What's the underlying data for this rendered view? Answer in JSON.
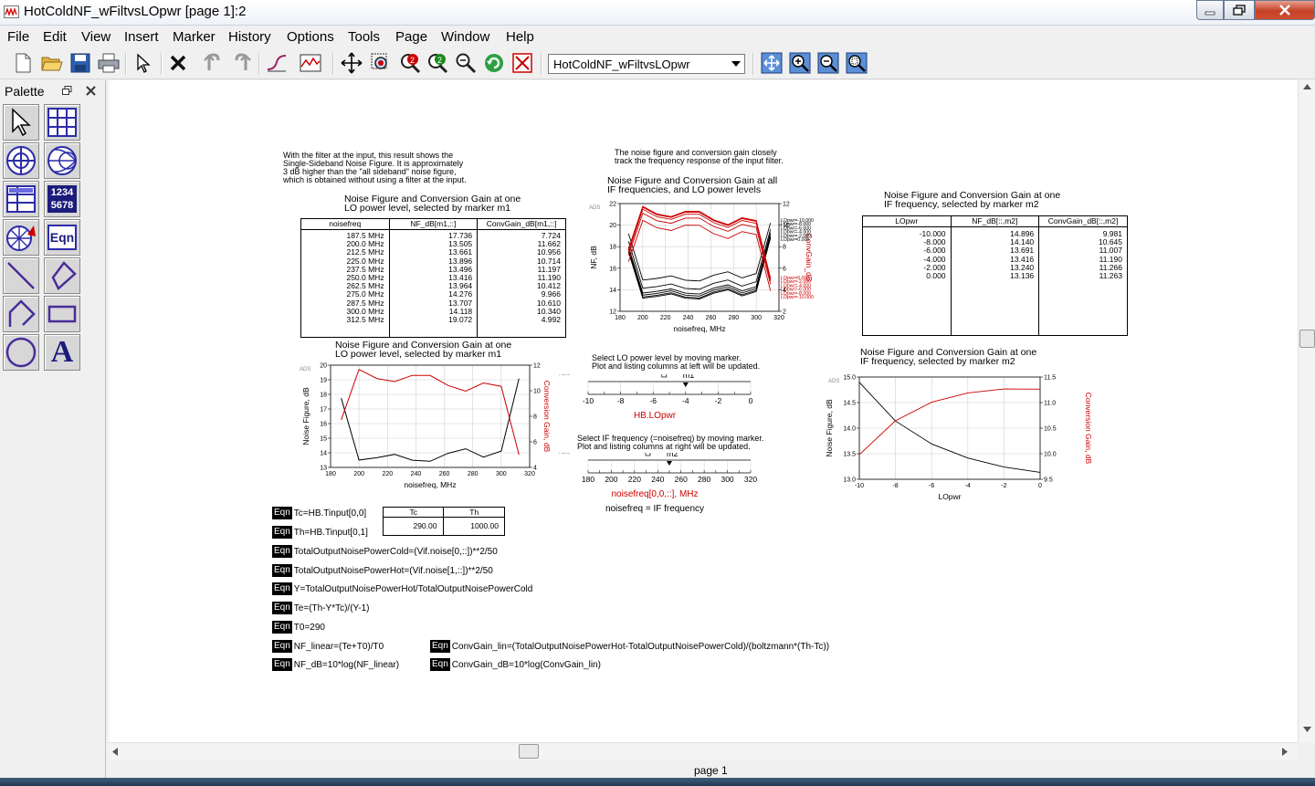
{
  "window": {
    "title": "HotColdNF_wFiltvsLOpwr [page 1]:2"
  },
  "menu": [
    "File",
    "Edit",
    "View",
    "Insert",
    "Marker",
    "History",
    "Options",
    "Tools",
    "Page",
    "Window",
    "Help"
  ],
  "toolbar": {
    "page_select": "HotColdNF_wFiltvsLOpwr"
  },
  "palette": {
    "title": "Palette",
    "counter_icon_text": [
      "1234",
      "5678"
    ],
    "eqn_icon_text": "Eqn",
    "text_icon_text": "A"
  },
  "notes": {
    "filter_note": [
      "With the filter at the input, this result shows the",
      "Single-Sideband Noise Figure.  It is approximately",
      "3 dB higher than the \"all sideband\" noise figure,",
      "which is obtained without using a filter at the input."
    ],
    "track_note": [
      "The noise figure and conversion gain closely",
      "track the frequency response of the input filter."
    ],
    "lo_marker_note": [
      "Select LO power level by moving marker.",
      "Plot and listing columns at left will be updated."
    ],
    "if_marker_note": [
      "Select IF frequency (=noisefreq) by moving marker.",
      "Plot and listing columns at right will be updated."
    ]
  },
  "table1": {
    "title": [
      "Noise Figure and Conversion Gain at one",
      "LO power level, selected by marker m1"
    ],
    "headers": [
      "noisefreq",
      "NF_dB[m1,::]",
      "ConvGain_dB[m1,::]"
    ],
    "col1": "187.5 MHz\n200.0 MHz\n212.5 MHz\n225.0 MHz\n237.5 MHz\n250.0 MHz\n262.5 MHz\n275.0 MHz\n287.5 MHz\n300.0 MHz\n312.5 MHz",
    "col2": "17.736\n13.505\n13.661\n13.896\n13.496\n13.416\n13.964\n14.276\n13.707\n14.118\n19.072",
    "col3": "7.724\n11.662\n10.956\n10.714\n11.197\n11.190\n10.412\n9.966\n10.610\n10.340\n4.992"
  },
  "table2": {
    "title": [
      "Noise Figure and Conversion Gain at one",
      "IF frequency, selected by marker m2"
    ],
    "headers": [
      "LOpwr",
      "NF_dB[::,m2]",
      "ConvGain_dB[::,m2]"
    ],
    "col1": "-10.000\n-8.000\n-6.000\n-4.000\n-2.000\n0.000",
    "col2": "14.896\n14.140\n13.691\n13.416\n13.240\n13.136",
    "col3": "9.981\n10.645\n11.007\n11.190\n11.266\n11.263"
  },
  "plot_all": {
    "title": [
      "Noise Figure and Conversion Gain at all",
      "IF frequencies, and LO power levels"
    ],
    "ylabel": "NF, dB",
    "y2label": "ConvGain_dB",
    "xlabel": "noisefreq, MHz",
    "ads": "ADS",
    "legend_top": [
      "LOpwr=-10.000",
      "LOpwr=-8.000",
      "LOpwr=-6.000",
      "LOpwr=-4.000",
      "LOpwr=-2.000",
      "LOpwr=0.000"
    ],
    "legend_bottom": [
      "LOpwr=0.000",
      "LOpwr=-2.000",
      "LOpwr=-4.000",
      "LOpwr=-6.000",
      "LOpwr=-8.000",
      "LOpwr=-10.000"
    ]
  },
  "plot_m1": {
    "title": [
      "Noise Figure and Conversion Gain at one",
      "LO power level, selected by marker m1"
    ],
    "ylabel": "Noise Figure, dB",
    "y2label": "Conversion Gain, dB",
    "xlabel": "noisefreq, MHz",
    "ads": "ADS"
  },
  "plot_m2": {
    "title": [
      "Noise Figure and Conversion Gain at one",
      "IF frequency, selected by marker m2"
    ],
    "ylabel": "Noise Figure, dB",
    "y2label": "Conversion Gain, dB",
    "xlabel": "LOpwr",
    "ads": "ADS"
  },
  "slider_lo": {
    "marker": "m1",
    "label": "HB.LOpwr",
    "ads": "ADS",
    "ticks": [
      "-10",
      "-8",
      "-6",
      "-4",
      "-2",
      "0"
    ],
    "value": -4
  },
  "slider_if": {
    "marker": "m2",
    "label": "noisefreq[0,0,::], MHz",
    "note": "noisefreq = IF frequency",
    "ads": "ADS",
    "ticks": [
      "180",
      "200",
      "220",
      "240",
      "260",
      "280",
      "300",
      "320"
    ],
    "value": 250
  },
  "tc_th": {
    "headers": [
      "Tc",
      "Th"
    ],
    "values": [
      "290.00",
      "1000.00"
    ]
  },
  "equations": {
    "badge": "Eqn",
    "left": [
      "Tc=HB.Tinput[0,0]",
      "Th=HB.Tinput[0,1]",
      "TotalOutputNoisePowerCold=(Vif.noise[0,::])**2/50",
      "TotalOutputNoisePowerHot=(Vif.noise[1,::])**2/50",
      "Y=TotalOutputNoisePowerHot/TotalOutputNoisePowerCold",
      "Te=(Th-Y*Tc)/(Y-1)",
      "T0=290",
      "NF_linear=(Te+T0)/T0",
      "NF_dB=10*log(NF_linear)"
    ],
    "right": [
      "ConvGain_lin=(TotalOutputNoisePowerHot-TotalOutputNoisePowerCold)/(boltzmann*(Th-Tc))",
      "ConvGain_dB=10*log(ConvGain_lin)"
    ]
  },
  "status": {
    "page": "page 1"
  },
  "chart_data": [
    {
      "type": "line",
      "title": "Noise Figure and Conversion Gain at all IF frequencies, and LO power levels",
      "x": [
        187.5,
        200,
        212.5,
        225,
        237.5,
        250,
        262.5,
        275,
        287.5,
        300,
        312.5
      ],
      "xlabel": "noisefreq, MHz",
      "ylabel": "NF, dB",
      "y2label": "ConvGain_dB",
      "xlim": [
        180,
        320
      ],
      "ylim": [
        12,
        22
      ],
      "y2lim": [
        2,
        12
      ],
      "series": [
        {
          "name": "LOpwr=-10.000",
          "axis": "left",
          "color": "#000000",
          "values": [
            19.2,
            14.896,
            15.05,
            15.29,
            14.89,
            14.81,
            15.36,
            15.67,
            15.1,
            15.51,
            20.2
          ]
        },
        {
          "name": "LOpwr=-8.000",
          "axis": "left",
          "color": "#000000",
          "values": [
            18.5,
            14.14,
            14.3,
            14.53,
            14.13,
            14.05,
            14.6,
            14.91,
            14.34,
            14.75,
            19.6
          ]
        },
        {
          "name": "LOpwr=-6.000",
          "axis": "left",
          "color": "#000000",
          "values": [
            18.0,
            13.691,
            13.85,
            14.08,
            13.69,
            13.6,
            14.15,
            14.46,
            13.89,
            14.3,
            19.3
          ]
        },
        {
          "name": "LOpwr=-4.000",
          "axis": "left",
          "color": "#000000",
          "values": [
            17.736,
            13.505,
            13.661,
            13.896,
            13.496,
            13.416,
            13.964,
            14.276,
            13.707,
            14.118,
            19.072
          ]
        },
        {
          "name": "LOpwr=-2.000",
          "axis": "left",
          "color": "#000000",
          "values": [
            17.6,
            13.33,
            13.49,
            13.72,
            13.32,
            13.24,
            13.79,
            14.1,
            13.53,
            13.94,
            18.9
          ]
        },
        {
          "name": "LOpwr=0.000",
          "axis": "left",
          "color": "#000000",
          "values": [
            17.5,
            13.22,
            13.38,
            13.61,
            13.21,
            13.14,
            13.68,
            13.99,
            13.42,
            13.83,
            18.8
          ]
        },
        {
          "name": "LOpwr=-10.000",
          "axis": "right",
          "color": "#cc0000",
          "values": [
            6.6,
            10.45,
            9.75,
            9.5,
            9.99,
            9.98,
            9.2,
            8.75,
            9.4,
            9.13,
            3.9
          ]
        },
        {
          "name": "LOpwr=-8.000",
          "axis": "right",
          "color": "#cc0000",
          "values": [
            7.2,
            11.11,
            10.41,
            10.17,
            10.65,
            10.65,
            9.87,
            9.42,
            10.06,
            9.79,
            4.5
          ]
        },
        {
          "name": "LOpwr=-6.000",
          "axis": "right",
          "color": "#cc0000",
          "values": [
            7.5,
            11.48,
            10.77,
            10.53,
            11.01,
            11.01,
            10.23,
            9.78,
            10.43,
            10.16,
            4.8
          ]
        },
        {
          "name": "LOpwr=-4.000",
          "axis": "right",
          "color": "#cc0000",
          "values": [
            7.724,
            11.662,
            10.956,
            10.714,
            11.197,
            11.19,
            10.412,
            9.966,
            10.61,
            10.34,
            4.992
          ]
        },
        {
          "name": "LOpwr=-2.000",
          "axis": "right",
          "color": "#cc0000",
          "values": [
            7.8,
            11.74,
            11.03,
            10.79,
            11.27,
            11.27,
            10.49,
            10.04,
            10.69,
            10.42,
            5.07
          ]
        },
        {
          "name": "LOpwr=0.000",
          "axis": "right",
          "color": "#cc0000",
          "values": [
            7.8,
            11.73,
            11.03,
            10.79,
            11.27,
            11.26,
            10.48,
            10.04,
            10.68,
            10.41,
            5.06
          ]
        }
      ]
    },
    {
      "type": "line",
      "title": "Noise Figure and Conversion Gain at one LO power level, selected by marker m1",
      "x": [
        187.5,
        200,
        212.5,
        225,
        237.5,
        250,
        262.5,
        275,
        287.5,
        300,
        312.5
      ],
      "xlabel": "noisefreq, MHz",
      "ylabel": "Noise Figure, dB",
      "y2label": "Conversion Gain, dB",
      "xlim": [
        180,
        320
      ],
      "ylim": [
        13,
        20
      ],
      "y2lim": [
        4,
        12
      ],
      "series": [
        {
          "name": "NF_dB",
          "axis": "left",
          "color": "#000000",
          "values": [
            17.736,
            13.505,
            13.661,
            13.896,
            13.496,
            13.416,
            13.964,
            14.276,
            13.707,
            14.118,
            19.072
          ]
        },
        {
          "name": "ConvGain_dB",
          "axis": "right",
          "color": "#cc0000",
          "values": [
            7.724,
            11.662,
            10.956,
            10.714,
            11.197,
            11.19,
            10.412,
            9.966,
            10.61,
            10.34,
            4.992
          ]
        }
      ]
    },
    {
      "type": "line",
      "title": "Noise Figure and Conversion Gain at one IF frequency, selected by marker m2",
      "x": [
        -10,
        -8,
        -6,
        -4,
        -2,
        0
      ],
      "xlabel": "LOpwr",
      "ylabel": "Noise Figure, dB",
      "y2label": "Conversion Gain, dB",
      "xlim": [
        -10,
        0
      ],
      "ylim": [
        13,
        15
      ],
      "y2lim": [
        9.5,
        11.5
      ],
      "series": [
        {
          "name": "NF_dB",
          "axis": "left",
          "color": "#000000",
          "values": [
            14.896,
            14.14,
            13.691,
            13.416,
            13.24,
            13.136
          ]
        },
        {
          "name": "ConvGain_dB",
          "axis": "right",
          "color": "#cc0000",
          "values": [
            9.981,
            10.645,
            11.007,
            11.19,
            11.266,
            11.263
          ]
        }
      ]
    }
  ]
}
